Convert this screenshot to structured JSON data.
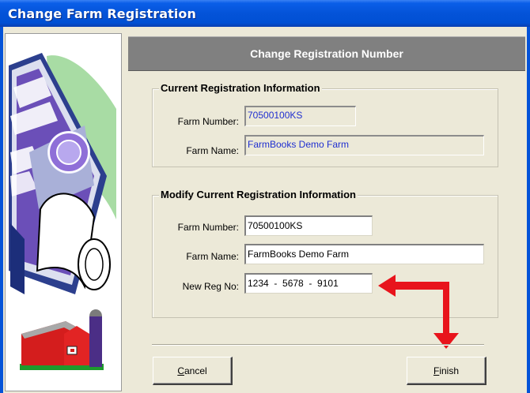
{
  "window": {
    "title": "Change Farm Registration"
  },
  "header": {
    "title": "Change Registration Number"
  },
  "current_group": {
    "legend": "Current Registration Information",
    "farm_number_label": "Farm Number:",
    "farm_number_value": "70500100KS",
    "farm_name_label": "Farm Name:",
    "farm_name_value": "FarmBooks Demo Farm"
  },
  "modify_group": {
    "legend": "Modify Current Registration Information",
    "farm_number_label": "Farm Number:",
    "farm_number_value": "70500100KS",
    "farm_name_label": "Farm Name:",
    "farm_name_value": "FarmBooks Demo Farm",
    "new_reg_label": "New Reg No:",
    "new_reg_value": "1234  -  5678  -  9101"
  },
  "buttons": {
    "cancel_rest": "ancel",
    "cancel_mnemonic": "C",
    "finish_rest": "inish",
    "finish_mnemonic": "F"
  },
  "colors": {
    "title_bar": "#0453d8",
    "header_bar": "#808080",
    "dialog_face": "#ece9d8",
    "readonly_text": "#1f2fd0",
    "arrow": "#e8141c"
  },
  "icons": {
    "certificate": "certificate-scroll-icon",
    "barn": "barn-icon",
    "arrow": "red-arrow-annotation"
  }
}
